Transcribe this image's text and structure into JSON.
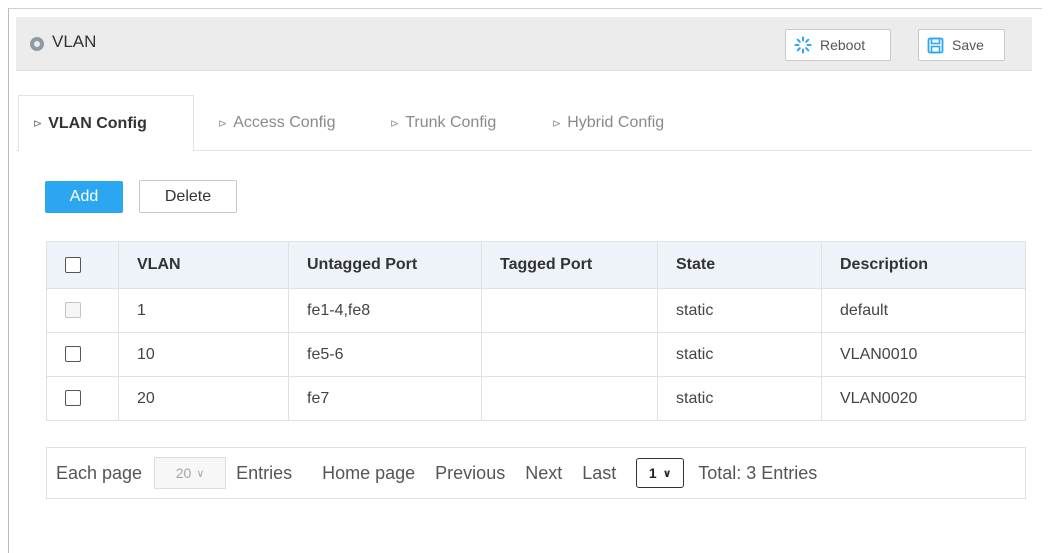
{
  "header": {
    "title": "VLAN",
    "reboot_label": "Reboot",
    "save_label": "Save",
    "reboot_icon": "loading-spinner-icon",
    "save_icon": "floppy-disk-icon"
  },
  "tabs": [
    {
      "label": "VLAN Config",
      "active": true
    },
    {
      "label": "Access Config",
      "active": false
    },
    {
      "label": "Trunk Config",
      "active": false
    },
    {
      "label": "Hybrid Config",
      "active": false
    }
  ],
  "actions": {
    "add_label": "Add",
    "delete_label": "Delete"
  },
  "table": {
    "columns": [
      "VLAN",
      "Untagged Port",
      "Tagged Port",
      "State",
      "Description"
    ],
    "rows": [
      {
        "vlan": "1",
        "untagged": "fe1-4,fe8",
        "tagged": "",
        "state": "static",
        "description": "default",
        "checkbox_disabled": true
      },
      {
        "vlan": "10",
        "untagged": "fe5-6",
        "tagged": "",
        "state": "static",
        "description": "VLAN0010",
        "checkbox_disabled": false
      },
      {
        "vlan": "20",
        "untagged": "fe7",
        "tagged": "",
        "state": "static",
        "description": "VLAN0020",
        "checkbox_disabled": false
      }
    ]
  },
  "pagination": {
    "each_page_label": "Each page",
    "page_size": "20",
    "entries_label": "Entries",
    "home_label": "Home page",
    "previous_label": "Previous",
    "next_label": "Next",
    "last_label": "Last",
    "current_page": "1",
    "total_label": "Total: 3 Entries"
  },
  "colors": {
    "accent": "#2aa7f0",
    "header_bg": "#ececec",
    "table_header_bg": "#edf3f9"
  }
}
